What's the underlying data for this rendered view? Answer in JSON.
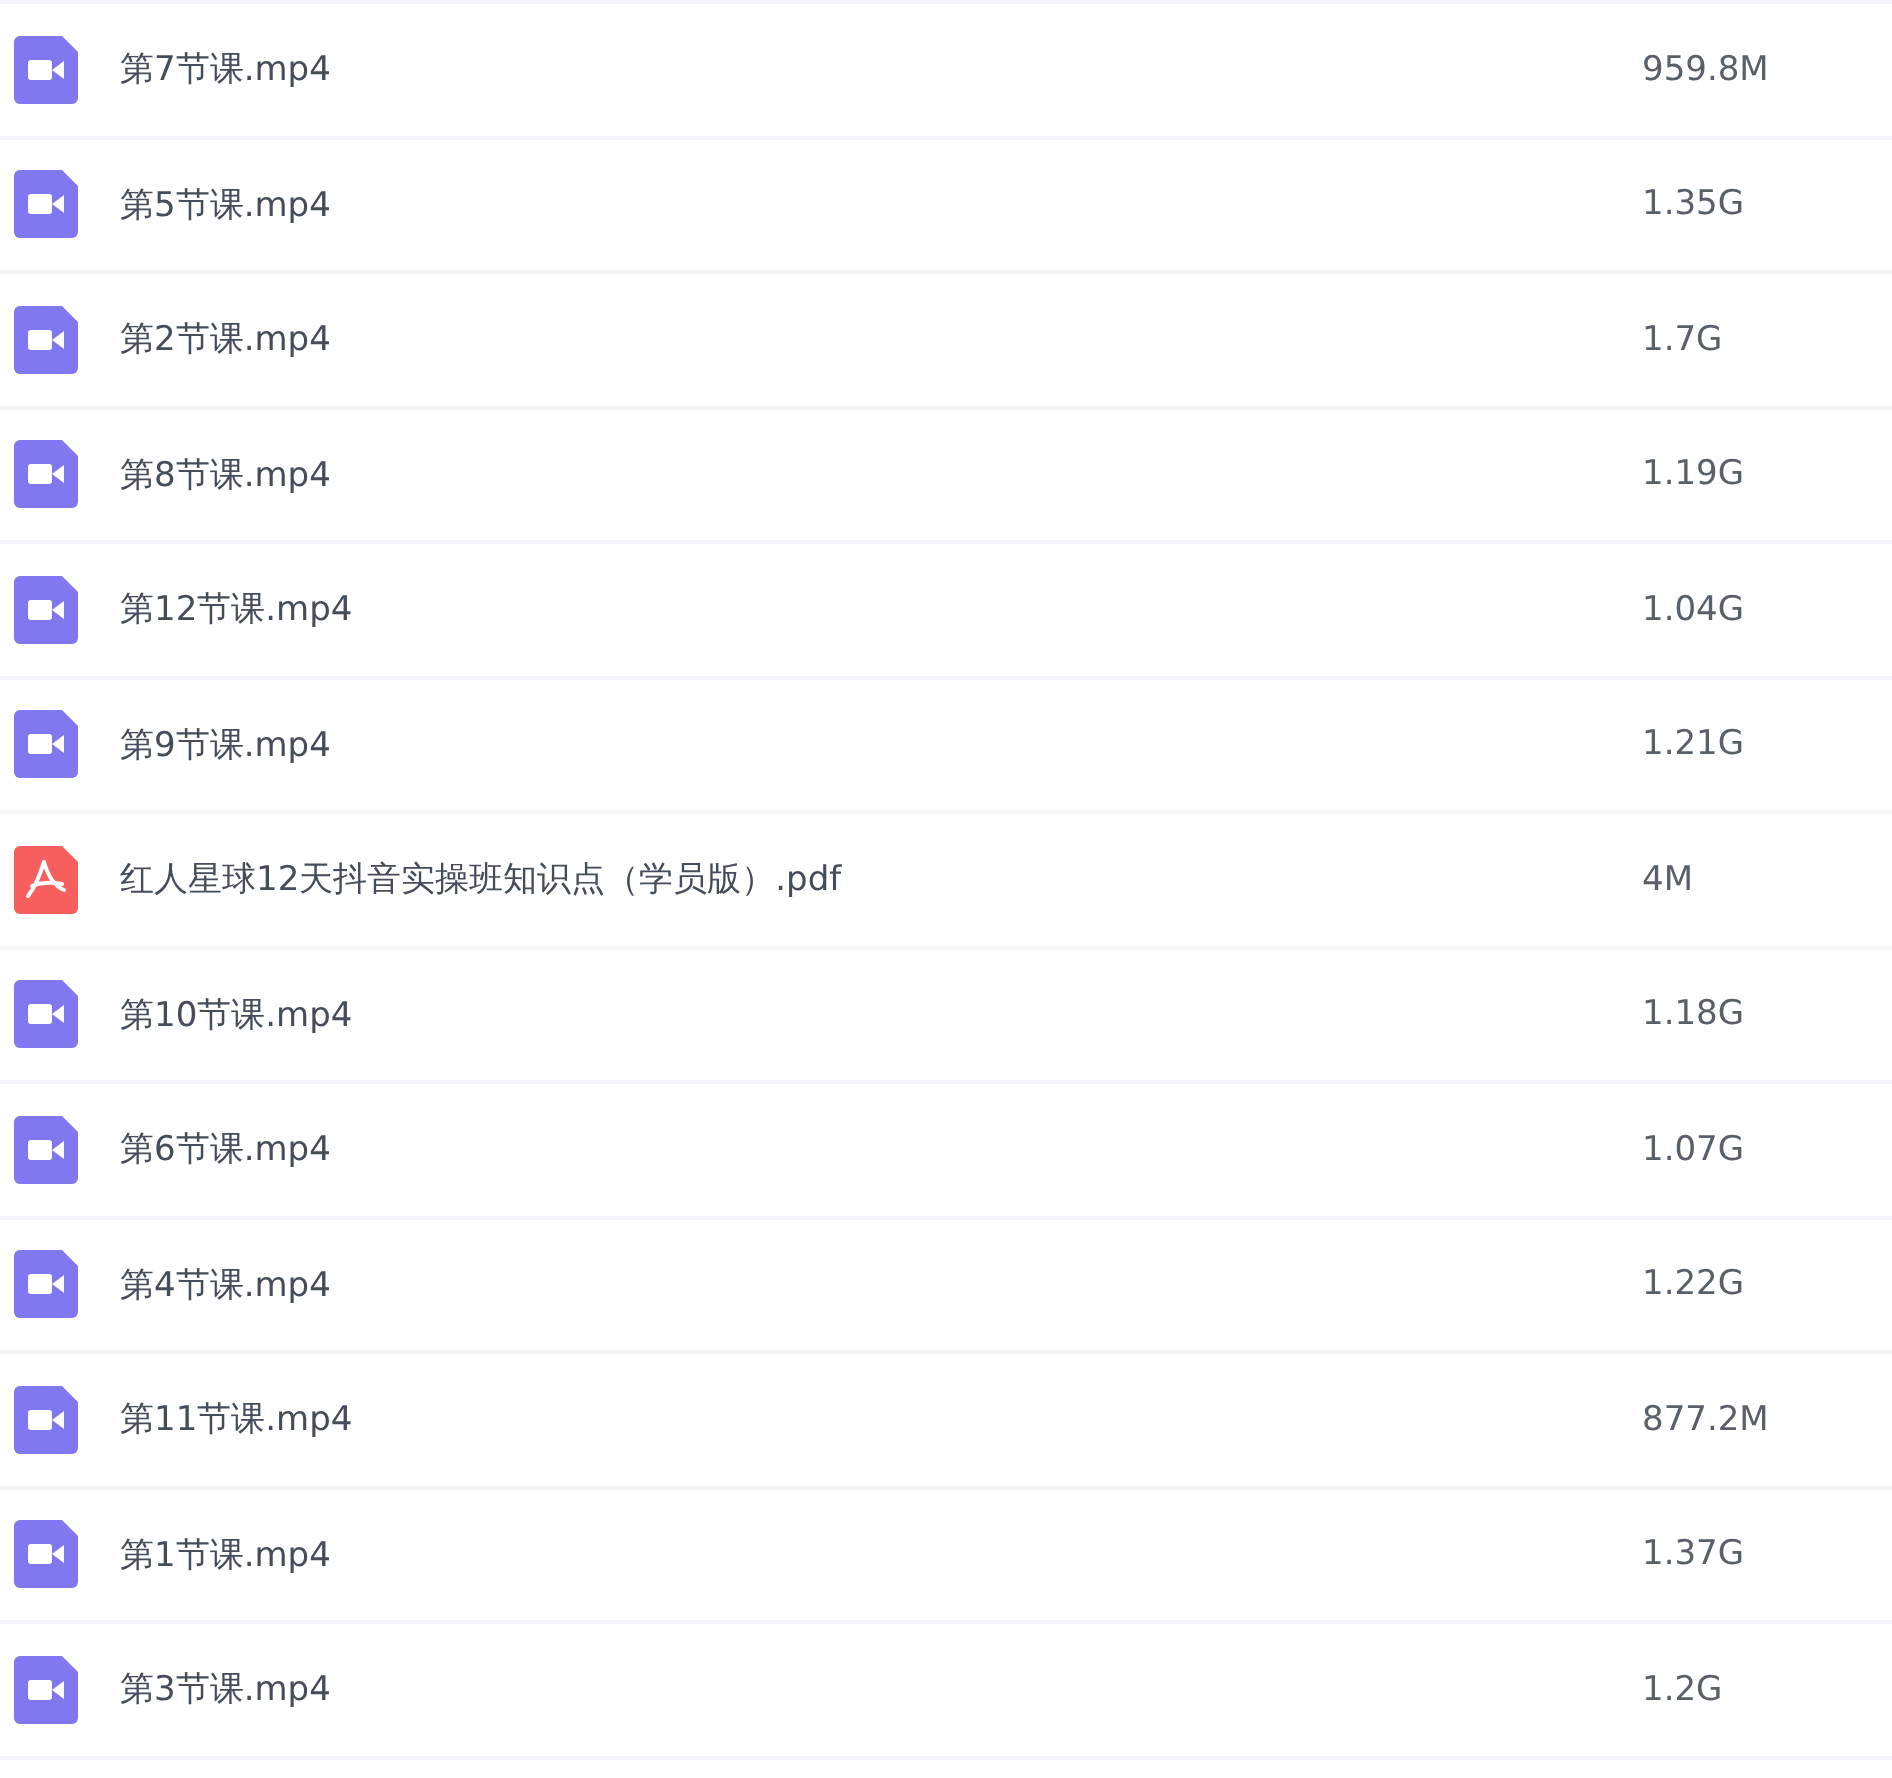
{
  "files": [
    {
      "kind": "video",
      "name": "第7节课.mp4",
      "size": "959.8M"
    },
    {
      "kind": "video",
      "name": "第5节课.mp4",
      "size": "1.35G"
    },
    {
      "kind": "video",
      "name": "第2节课.mp4",
      "size": "1.7G"
    },
    {
      "kind": "video",
      "name": "第8节课.mp4",
      "size": "1.19G"
    },
    {
      "kind": "video",
      "name": "第12节课.mp4",
      "size": "1.04G"
    },
    {
      "kind": "video",
      "name": "第9节课.mp4",
      "size": "1.21G"
    },
    {
      "kind": "pdf",
      "name": "红人星球12天抖音实操班知识点（学员版）.pdf",
      "size": "4M"
    },
    {
      "kind": "video",
      "name": "第10节课.mp4",
      "size": "1.18G"
    },
    {
      "kind": "video",
      "name": "第6节课.mp4",
      "size": "1.07G"
    },
    {
      "kind": "video",
      "name": "第4节课.mp4",
      "size": "1.22G"
    },
    {
      "kind": "video",
      "name": "第11节课.mp4",
      "size": "877.2M"
    },
    {
      "kind": "video",
      "name": "第1节课.mp4",
      "size": "1.37G"
    },
    {
      "kind": "video",
      "name": "第3节课.mp4",
      "size": "1.2G"
    }
  ]
}
